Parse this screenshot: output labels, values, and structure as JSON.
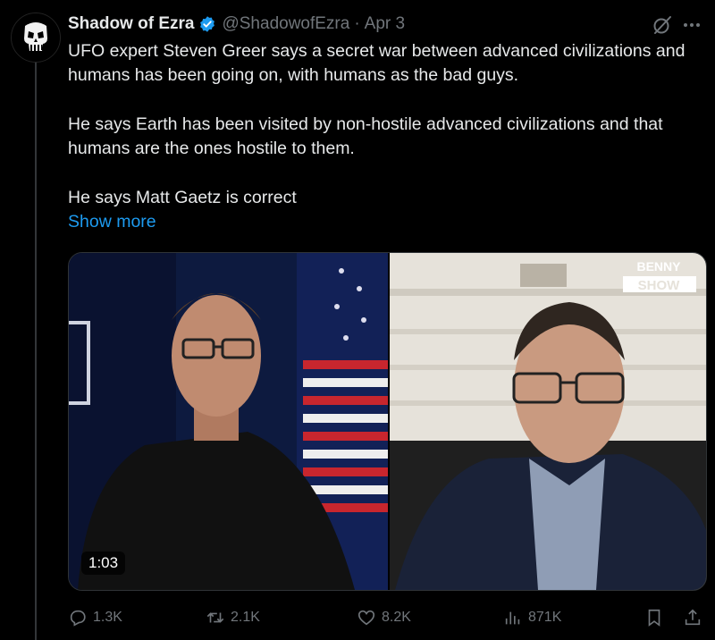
{
  "post": {
    "author_name": "Shadow of Ezra",
    "handle": "@ShadowofEzra",
    "separator": "·",
    "date": "Apr 3",
    "paragraphs": [
      "UFO expert Steven Greer says a secret war between advanced civilizations and humans has been going on, with humans as the bad guys.",
      "He says Earth has been visited by non-hostile advanced civilizations and that humans are the ones hostile to them.",
      "He says Matt Gaetz is correct"
    ],
    "show_more": "Show more"
  },
  "video": {
    "duration": "1:03",
    "overlay_logo": "BENNY SHOW"
  },
  "actions": {
    "replies": "1.3K",
    "reposts": "2.1K",
    "likes": "8.2K",
    "views": "871K"
  },
  "colors": {
    "background": "#000000",
    "text": "#e7e9ea",
    "muted": "#71767b",
    "link": "#1d9bf0",
    "verified": "#1d9bf0"
  },
  "icons": [
    "skull-avatar-icon",
    "verified-badge-icon",
    "grok-icon",
    "more-icon",
    "reply-icon",
    "repost-icon",
    "like-icon",
    "views-icon",
    "bookmark-icon",
    "share-icon"
  ]
}
